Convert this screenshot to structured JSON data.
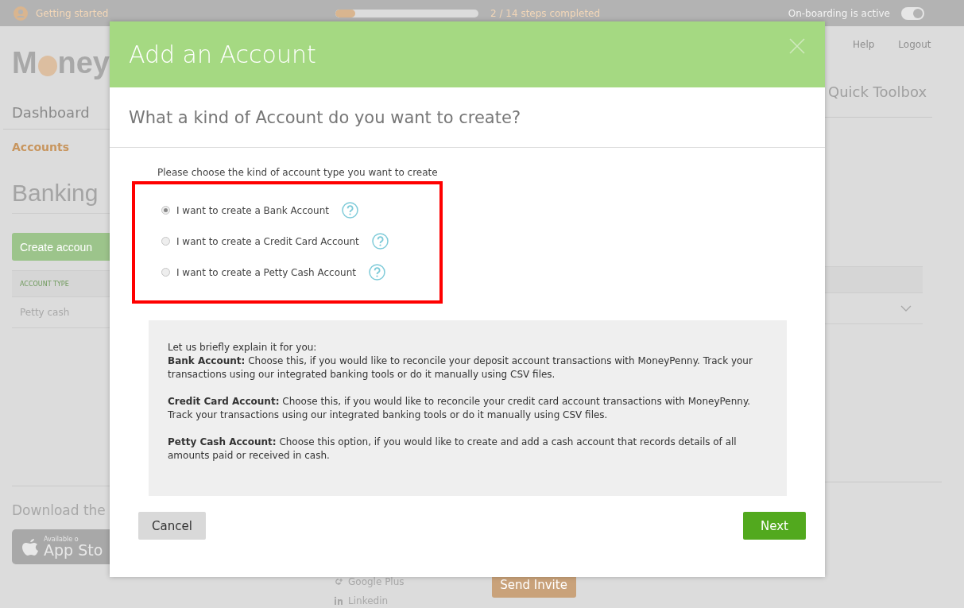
{
  "top_bar": {
    "getting_started": "Getting started",
    "progress": {
      "level": 0.14
    },
    "steps": "2 / 14 steps completed",
    "onboarding_label": "On-boarding is active",
    "onboarding_on": true
  },
  "header": {
    "logo_start": "M",
    "logo_end": "ney",
    "links": [
      "Help",
      "Logout"
    ]
  },
  "nav": {
    "items": [
      {
        "label": "Dashboard",
        "selected": false
      }
    ],
    "quick_toolbox": "Quick Toolbox"
  },
  "subnav": {
    "items": [
      {
        "label": "Accounts",
        "selected": true
      }
    ]
  },
  "page": {
    "title": "Banking",
    "create_button": "Create accoun",
    "table": {
      "columns": [
        "ACCOUNT TYPE"
      ],
      "rows": [
        {
          "cells": [
            "Petty cash"
          ]
        }
      ]
    }
  },
  "footer": {
    "download": "Download the",
    "store_small": "Available o",
    "store_big": "App Sto",
    "social": [
      {
        "kind": "googleplus",
        "label": "Google Plus"
      },
      {
        "kind": "linkedin",
        "label": "Linkedin"
      }
    ],
    "send_invite": "Send Invite"
  },
  "dialog": {
    "title": "Add an Account",
    "question": "What a kind of Account do you want to create?",
    "instruction": "Please choose the kind of account type you want to create",
    "options": [
      {
        "label": "I want to create a Bank Account",
        "selected": true
      },
      {
        "label": "I want to create a Credit Card Account",
        "selected": false
      },
      {
        "label": "I want to create a Petty Cash Account",
        "selected": false
      }
    ],
    "explanation": {
      "intro": "Let us briefly explain it for you:",
      "paragraphs": [
        "**Bank Account:** Choose this, if you would like to reconcile your deposit account transactions with MoneyPenny. Track your transactions using our integrated banking tools or do it manually using CSV files.",
        "**Credit Card Account:** Choose this, if you would like to reconcile your credit card account transactions with MoneyPenny. Track your transactions using our integrated banking tools or do it manually using CSV files.",
        "**Petty Cash Account:** Choose this option, if you would like to create and add a cash account that records details of all amounts paid or received in cash."
      ]
    },
    "buttons": {
      "cancel": "Cancel",
      "next": "Next"
    }
  }
}
